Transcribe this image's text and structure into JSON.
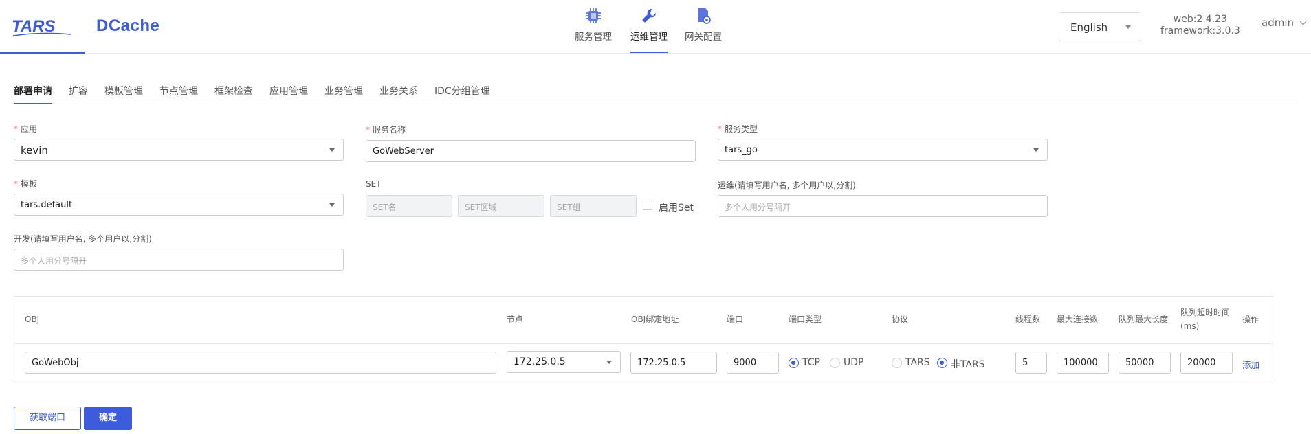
{
  "header": {
    "logo_tars": "TARS",
    "logo_dcache": "DCache",
    "nav": [
      {
        "label": "服务管理",
        "icon": "chip-icon"
      },
      {
        "label": "运维管理",
        "icon": "wrench-icon"
      },
      {
        "label": "网关配置",
        "icon": "gateway-config-icon"
      }
    ],
    "language": "English",
    "version_web": "web:2.4.23",
    "version_framework": "framework:3.0.3",
    "user": "admin"
  },
  "tabs": [
    "部署申请",
    "扩容",
    "模板管理",
    "节点管理",
    "框架检查",
    "应用管理",
    "业务管理",
    "业务关系",
    "IDC分组管理"
  ],
  "form": {
    "app_label": "应用",
    "app_value": "kevin",
    "server_name_label": "服务名称",
    "server_name_value": "GoWebServer",
    "server_type_label": "服务类型",
    "server_type_value": "tars_go",
    "template_label": "模板",
    "template_value": "tars.default",
    "set_label": "SET",
    "set_name_placeholder": "SET名",
    "set_area_placeholder": "SET区域",
    "set_group_placeholder": "SET组",
    "enable_set_label": "启用Set",
    "ops_label": "运维(请填写用户名, 多个用户以,分割)",
    "ops_placeholder": "多个人用分号隔开",
    "dev_label": "开发(请填写用户名, 多个用户以,分割)",
    "dev_placeholder": "多个人用分号隔开"
  },
  "table": {
    "headers": {
      "obj": "OBJ",
      "node": "节点",
      "bind": "OBJ绑定地址",
      "port": "端口",
      "port_type": "端口类型",
      "protocol": "协议",
      "threads": "线程数",
      "max_conn": "最大连接数",
      "queue_len": "队列最大长度",
      "queue_timeout": "队列超时时间(ms)",
      "ops": "操作"
    },
    "row": {
      "obj": "GoWebObj",
      "node": "172.25.0.5",
      "bind": "172.25.0.5",
      "port": "9000",
      "tcp": "TCP",
      "udp": "UDP",
      "tars": "TARS",
      "non_tars": "非TARS",
      "threads": "5",
      "max_conn": "100000",
      "queue_len": "50000",
      "queue_timeout": "20000",
      "add": "添加"
    }
  },
  "buttons": {
    "get_port": "获取端口",
    "confirm": "确定"
  },
  "colors": {
    "accent": "#3d5cdb",
    "required": "#f56c6c"
  }
}
